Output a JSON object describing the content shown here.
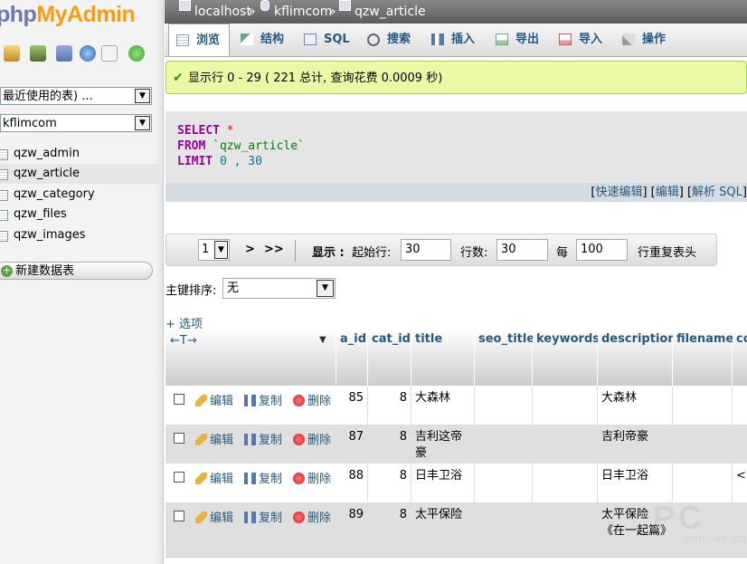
{
  "nav": {
    "logo_php": "php",
    "logo_myadmin": "MyAdmin",
    "recent_select": "最近使用的表) ...",
    "db_select": "kflimcom",
    "tables": [
      "qzw_admin",
      "qzw_article",
      "qzw_category",
      "qzw_files",
      "qzw_images"
    ],
    "active_table": "qzw_article",
    "new_db": "新建数据表"
  },
  "breadcrumb": {
    "server": "localhost",
    "sep1": "»",
    "db": "kflimcom",
    "sep2": "»",
    "table": "qzw_article"
  },
  "tabs": [
    "浏览",
    "结构",
    "SQL",
    "搜索",
    "插入",
    "导出",
    "导入",
    "操作"
  ],
  "active_tab": "浏览",
  "message": "显示行 0 - 29 ( 221 总计, 查询花费 0.0009 秒)",
  "sql": {
    "select": "SELECT",
    "star": "*",
    "from": "FROM",
    "table": "`qzw_article`",
    "limit": "LIMIT",
    "offset": "0",
    "comma": ",",
    "count": "30"
  },
  "sql_links": {
    "lb1": "[",
    "quick_edit": "快速编辑",
    "rb1": "] [",
    "edit": "编辑",
    "rb2": "] [",
    "explain": "解析 SQL",
    "rb3": "]"
  },
  "navbar": {
    "page_select": "1",
    "next": ">",
    "last": ">>",
    "show_label": "显示 :",
    "start_label": "起始行:",
    "start_value": "30",
    "rows_label": "行数:",
    "rows_value": "30",
    "every_label": "每",
    "every_value": "100",
    "repeat_label": "行重复表头"
  },
  "sort": {
    "label": "主键排序:",
    "value": "无"
  },
  "options_link": "+ 选项",
  "columns": [
    "a_id",
    "cat_id",
    "title",
    "seo_title",
    "keywords",
    "description",
    "filename",
    "co"
  ],
  "actions": {
    "edit": "编辑",
    "copy": "复制",
    "delete": "删除"
  },
  "rows": [
    {
      "a_id": "85",
      "cat_id": "8",
      "title": "大森林",
      "description": "大森林",
      "extra": ""
    },
    {
      "a_id": "87",
      "cat_id": "8",
      "title": "吉利这帝豪",
      "description": "吉利帝豪",
      "extra": ""
    },
    {
      "a_id": "88",
      "cat_id": "8",
      "title": "日丰卫浴",
      "description": "日丰卫浴",
      "extra": "<"
    },
    {
      "a_id": "89",
      "cat_id": "8",
      "title": "太平保险",
      "description": "太平保险《在一起篇》",
      "extra": ""
    }
  ],
  "watermark": {
    "big": "PC",
    "small": "PHPCMS.CN"
  },
  "colors": {
    "link": "#235a81",
    "success_bg": "#ebf8a4",
    "keyword": "#990099"
  }
}
